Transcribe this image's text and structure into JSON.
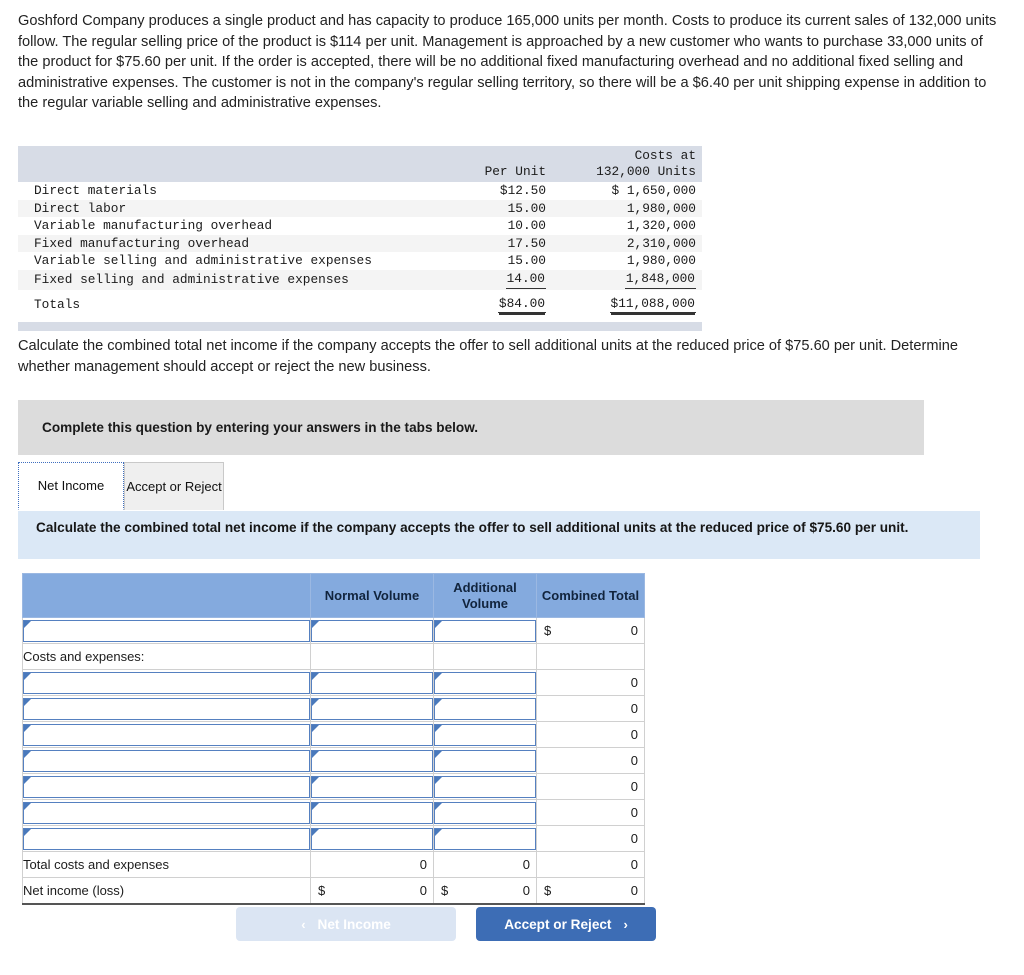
{
  "problem": {
    "statement": "Goshford Company produces a single product and has capacity to produce 165,000 units per month. Costs to produce its current sales of 132,000 units follow. The regular selling price of the product is $114 per unit. Management is approached by a new customer who wants to purchase 33,000 units of the product for $75.60 per unit. If the order is accepted, there will be no additional fixed manufacturing overhead and no additional fixed selling and administrative expenses. The customer is not in the company's regular selling territory, so there will be a $6.40 per unit shipping expense in addition to the regular variable selling and administrative expenses.",
    "sub_question": "Calculate the combined total net income if the company accepts the offer to sell additional units at the reduced price of $75.60 per unit. Determine whether management should accept or reject the new business."
  },
  "cost_table": {
    "headers": {
      "label": "",
      "per_unit": "Per Unit",
      "total_line1": "Costs at",
      "total_line2": "132,000 Units"
    },
    "rows": [
      {
        "label": "Direct materials",
        "per_unit": "$12.50",
        "total": "$ 1,650,000"
      },
      {
        "label": "Direct labor",
        "per_unit": "15.00",
        "total": "1,980,000"
      },
      {
        "label": "Variable manufacturing overhead",
        "per_unit": "10.00",
        "total": "1,320,000"
      },
      {
        "label": "Fixed manufacturing overhead",
        "per_unit": "17.50",
        "total": "2,310,000"
      },
      {
        "label": "Variable selling and administrative expenses",
        "per_unit": "15.00",
        "total": "1,980,000"
      },
      {
        "label": "Fixed selling and administrative expenses",
        "per_unit": "14.00",
        "total": "1,848,000"
      }
    ],
    "totals": {
      "label": "Totals",
      "per_unit": "$84.00",
      "total": "$11,088,000"
    }
  },
  "banner": {
    "text": "Complete this question by entering your answers in the tabs below."
  },
  "tabs": [
    {
      "label": "Net Income",
      "active": true
    },
    {
      "label": "Accept or Reject",
      "active": false
    }
  ],
  "tab_labels": {
    "net_income": "Net Income",
    "accept_or_reject": "Accept or Reject"
  },
  "instruction_bar": {
    "text": "Calculate the combined total net income if the company accepts the offer to sell additional units at the reduced price of $75.60 per unit."
  },
  "answer_grid": {
    "headers": {
      "blank": "",
      "normal_volume": "Normal Volume",
      "additional_volume": "Additional Volume",
      "combined_total": "Combined Total"
    },
    "rows": [
      {
        "type": "input",
        "label": "",
        "normal": "",
        "additional": "",
        "combined_dollar": "$",
        "combined": "0"
      },
      {
        "type": "section",
        "label": "Costs and expenses:"
      },
      {
        "type": "input",
        "label": "",
        "normal": "",
        "additional": "",
        "combined": "0"
      },
      {
        "type": "input",
        "label": "",
        "normal": "",
        "additional": "",
        "combined": "0"
      },
      {
        "type": "input",
        "label": "",
        "normal": "",
        "additional": "",
        "combined": "0"
      },
      {
        "type": "input",
        "label": "",
        "normal": "",
        "additional": "",
        "combined": "0"
      },
      {
        "type": "input",
        "label": "",
        "normal": "",
        "additional": "",
        "combined": "0"
      },
      {
        "type": "input",
        "label": "",
        "normal": "",
        "additional": "",
        "combined": "0"
      },
      {
        "type": "input",
        "label": "",
        "normal": "",
        "additional": "",
        "combined": "0"
      },
      {
        "type": "total",
        "label": "Total costs and expenses",
        "normal_dollar": "",
        "normal": "0",
        "additional_dollar": "",
        "additional": "0",
        "combined_dollar": "",
        "combined": "0"
      },
      {
        "type": "net",
        "label": "Net income (loss)",
        "normal_dollar": "$",
        "normal": "0",
        "additional_dollar": "$",
        "additional": "0",
        "combined_dollar": "$",
        "combined": "0"
      }
    ]
  },
  "footer": {
    "prev_label": "Net Income",
    "prev_chevron": "‹",
    "next_label": "Accept or Reject",
    "next_chevron": "›"
  },
  "colors": {
    "grid_header_blue": "#84aade",
    "instruction_blue": "#dbe8f6",
    "banner_grey": "#dcdcdc",
    "cost_header_grey": "#d7dce6",
    "next_button_blue": "#3d6db5",
    "prev_button_blue": "#dbe5f3",
    "input_border_blue": "#5580c0"
  }
}
